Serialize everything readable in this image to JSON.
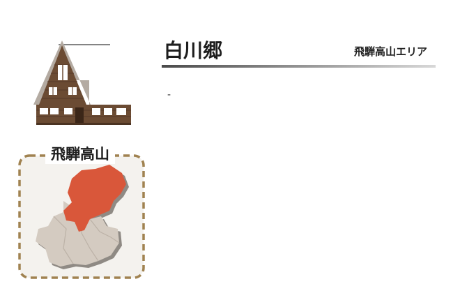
{
  "region": {
    "name": "飛騨高山",
    "highlight_color": "#d9573a",
    "base_color": "#d4cbc1",
    "border_color": "#a08250"
  },
  "header": {
    "title": "白川郷",
    "area": "飛騨高山エリア"
  },
  "content": {
    "text": "-"
  },
  "icons": {
    "house": "gassho-house-icon"
  }
}
